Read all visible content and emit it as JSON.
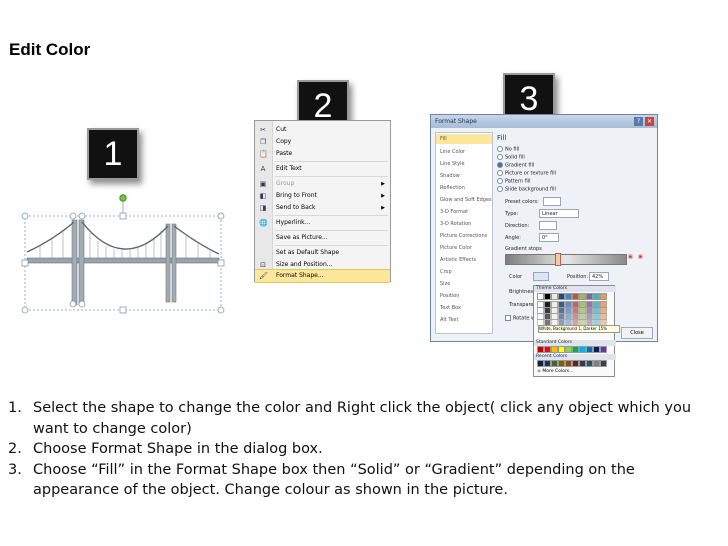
{
  "title": "Edit Color",
  "steps": [
    "1",
    "2",
    "3"
  ],
  "context_menu": {
    "items": [
      {
        "label": "Cut",
        "icon": "scissors-icon",
        "glyph": "✂"
      },
      {
        "label": "Copy",
        "icon": "copy-icon",
        "glyph": "❐"
      },
      {
        "label": "Paste",
        "icon": "paste-icon",
        "glyph": "📋"
      },
      {
        "label": "Edit Text",
        "icon": "edit-text-icon",
        "glyph": "A"
      },
      {
        "label": "Group",
        "icon": "group-icon",
        "glyph": "▣"
      },
      {
        "label": "Bring to Front",
        "icon": "bring-front-icon",
        "glyph": "◧"
      },
      {
        "label": "Send to Back",
        "icon": "send-back-icon",
        "glyph": "◨"
      },
      {
        "label": "Hyperlink...",
        "icon": "hyperlink-icon",
        "glyph": "🌐"
      },
      {
        "label": "Save as Picture...",
        "icon": "",
        "glyph": ""
      },
      {
        "label": "Set as Default Shape",
        "icon": "",
        "glyph": ""
      },
      {
        "label": "Size and Position...",
        "icon": "size-position-icon",
        "glyph": "⊡"
      },
      {
        "label": "Format Shape...",
        "icon": "format-shape-icon",
        "glyph": "🖌"
      }
    ]
  },
  "dialog": {
    "title": "Format Shape",
    "categories": [
      "Fill",
      "Line Color",
      "Line Style",
      "Shadow",
      "Reflection",
      "Glow and Soft Edges",
      "3-D Format",
      "3-D Rotation",
      "Picture Corrections",
      "Picture Color",
      "Artistic Effects",
      "Crop",
      "Size",
      "Position",
      "Text Box",
      "Alt Text"
    ],
    "section": "Fill",
    "fill_options": [
      "No fill",
      "Solid fill",
      "Gradient fill",
      "Picture or texture fill",
      "Pattern fill",
      "Slide background fill"
    ],
    "preset_colors_label": "Preset colors:",
    "type_label": "Type:",
    "type_value": "Linear",
    "direction_label": "Direction:",
    "angle_label": "Angle:",
    "angle_value": "0°",
    "gradient_stops_label": "Gradient stops",
    "color_label": "Color",
    "position_label": "Position:",
    "position_value": "42%",
    "brightness_label": "Brightness:",
    "transparency_label": "Transparen",
    "rotate_label": "Rotate w",
    "close_label": "Close"
  },
  "palette": {
    "theme_header": "Theme Colors",
    "standard_header": "Standard Colors",
    "recent_header": "Recent Colors",
    "tooltip": "White, Background 1, Darker 15%",
    "more_colors": "More Colors...",
    "theme_top": [
      "#ffffff",
      "#000000",
      "#eeece1",
      "#1f497d",
      "#4f81bd",
      "#c0504d",
      "#9bbb59",
      "#8064a2",
      "#4bacc6",
      "#f79646"
    ],
    "standard": [
      "#c00000",
      "#ff0000",
      "#ffc000",
      "#ffff00",
      "#92d050",
      "#00b050",
      "#00b0f0",
      "#0070c0",
      "#002060",
      "#7030a0"
    ],
    "recent": [
      "#0f243e",
      "#17365d",
      "#4f6228",
      "#7f6000",
      "#984806",
      "#632523",
      "#3f3151",
      "#205867",
      "#7f7f7f",
      "#404040"
    ]
  },
  "instructions": [
    {
      "num": "1.",
      "text": "Select the shape to change the color and Right click the object( click any object which you want to change color)"
    },
    {
      "num": "2.",
      "text": "Choose Format Shape in the dialog box."
    },
    {
      "num": "3.",
      "text": "Choose “Fill” in the Format Shape box then “Solid” or “Gradient” depending on the appearance of the object. Change colour as shown in the picture."
    }
  ]
}
